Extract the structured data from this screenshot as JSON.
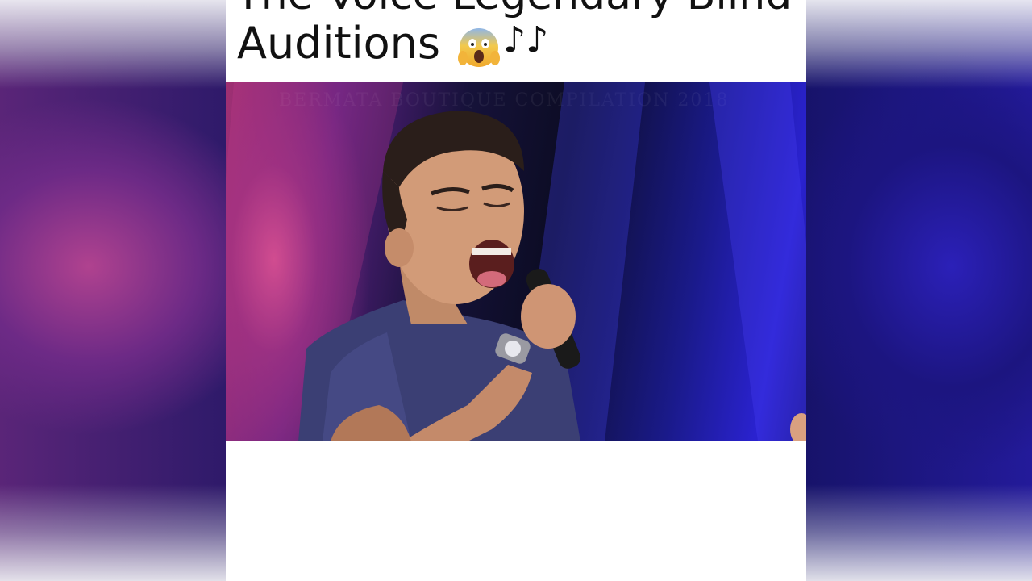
{
  "title": {
    "line1": "The Voice Legendary Blind",
    "line2": "Auditions",
    "emoji_icon": "screaming-face-emoji",
    "music_icon": "music-notes-emoji",
    "music_glyph": "♪♪"
  },
  "video": {
    "watermark": "BERMATA BOUTIQUE COMPILATION 2018"
  },
  "colors": {
    "panel_bg": "#ffffff",
    "stage_blue": "#2a22d0",
    "stage_pink": "#a03070"
  }
}
